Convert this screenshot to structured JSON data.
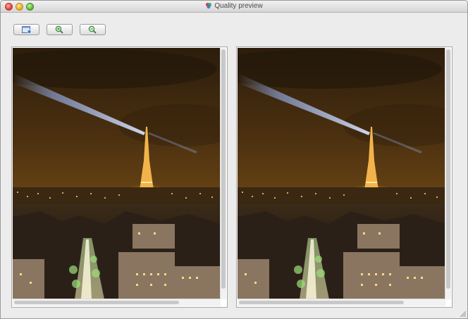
{
  "window": {
    "title": "Quality preview",
    "title_icon": "color-wheel-icon"
  },
  "toolbar": {
    "buttons": [
      {
        "name": "open-image-button",
        "icon": "image-window-icon"
      },
      {
        "name": "zoom-in-button",
        "icon": "magnifier-plus-icon"
      },
      {
        "name": "zoom-out-button",
        "icon": "magnifier-minus-icon"
      }
    ]
  },
  "panels": [
    {
      "name": "original-preview",
      "icon": "eiffel-tower-night-photo"
    },
    {
      "name": "compressed-preview",
      "icon": "eiffel-tower-night-photo"
    }
  ],
  "colors": {
    "window_bg": "#ececec",
    "sky": "#5a3a12",
    "city_lights": "#ffd27a",
    "beam": "#a8c4ff"
  }
}
